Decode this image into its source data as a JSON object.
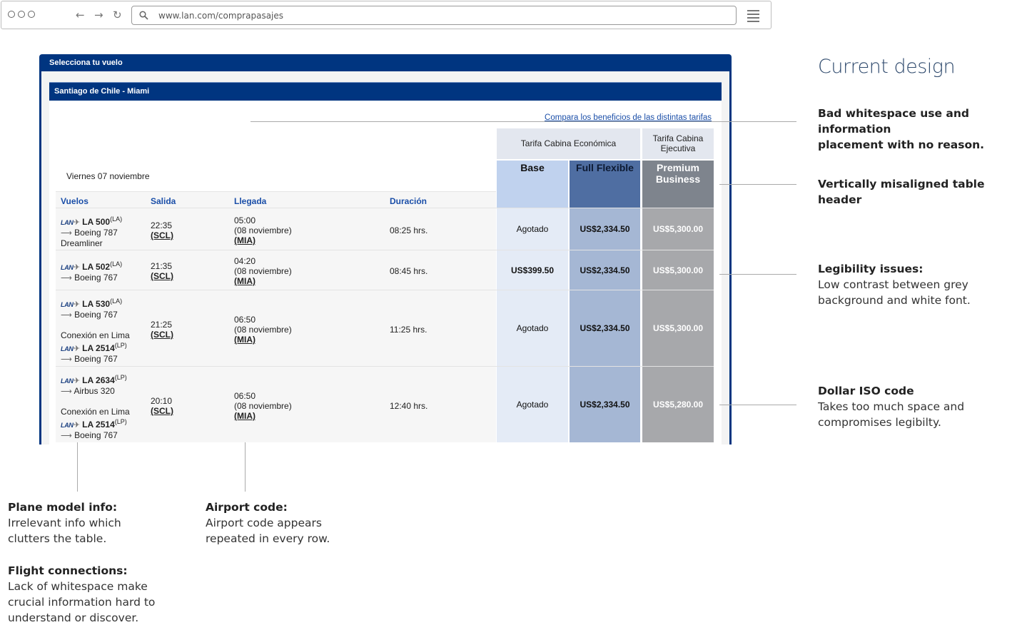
{
  "browser": {
    "url": "www.lan.com/comprapasajes"
  },
  "panel": {
    "title": "Selecciona tu vuelo",
    "route": "Santiago de Chile - Miami",
    "compare_link": "Compara los beneficios de las distintas tarifas",
    "date": "Viernes 07 noviembre",
    "fare_groups": {
      "economy": "Tarifa Cabina Económica",
      "executive_line1": "Tarifa Cabina",
      "executive_line2": "Ejecutiva"
    },
    "fares": {
      "base": "Base",
      "full": "Full Flexible",
      "premium_line1": "Premium",
      "premium_line2": "Business"
    },
    "columns": {
      "vuelos": "Vuelos",
      "salida": "Salida",
      "llegada": "Llegada",
      "duracion": "Duración"
    },
    "airline_logo": "LAN",
    "rows": [
      {
        "flight": "LA 500",
        "carrier": "(LA)",
        "plane": "Boeing 787",
        "plane2": "Dreamliner",
        "dep_time": "22:35",
        "dep_code": "(SCL)",
        "arr_time": "05:00",
        "arr_date": "(08 noviembre)",
        "arr_code": "(MIA)",
        "duration": "08:25 hrs.",
        "base": "Agotado",
        "full": "US$2,334.50",
        "premium": "US$5,300.00"
      },
      {
        "flight": "LA 502",
        "carrier": "(LA)",
        "plane": "Boeing 767",
        "dep_time": "21:35",
        "dep_code": "(SCL)",
        "arr_time": "04:20",
        "arr_date": "(08 noviembre)",
        "arr_code": "(MIA)",
        "duration": "08:45 hrs.",
        "base": "US$399.50",
        "full": "US$2,334.50",
        "premium": "US$5,300.00"
      },
      {
        "flight": "LA 530",
        "carrier": "(LA)",
        "plane": "Boeing 767",
        "connection": "Conexión en Lima",
        "flight2": "LA 2514",
        "carrier2": "(LP)",
        "plane2": "Boeing 767",
        "dep_time": "21:25",
        "dep_code": "(SCL)",
        "arr_time": "06:50",
        "arr_date": "(08 noviembre)",
        "arr_code": "(MIA)",
        "duration": "11:25 hrs.",
        "base": "Agotado",
        "full": "US$2,334.50",
        "premium": "US$5,300.00"
      },
      {
        "flight": "LA 2634",
        "carrier": "(LP)",
        "plane": "Airbus 320",
        "connection": "Conexión en Lima",
        "flight2": "LA 2514",
        "carrier2": "(LP)",
        "plane2": "Boeing 767",
        "dep_time": "20:10",
        "dep_code": "(SCL)",
        "arr_time": "06:50",
        "arr_date": "(08 noviembre)",
        "arr_code": "(MIA)",
        "duration": "12:40 hrs.",
        "base": "Agotado",
        "full": "US$2,334.50",
        "premium": "US$5,280.00"
      }
    ]
  },
  "annotations": {
    "title": "Current design",
    "whitespace": {
      "line1": "Bad whitespace use and information",
      "line2": "placement with no reason."
    },
    "header": {
      "title": "Vertically misaligned table header"
    },
    "legibility": {
      "title": "Legibility issues:",
      "line1": "Low contrast between grey",
      "line2": "background and white font."
    },
    "iso": {
      "title": "Dollar ISO code",
      "line1": "Takes too much space and",
      "line2": "compromises legibilty."
    },
    "plane": {
      "title": "Plane model info:",
      "line1": "Irrelevant info which",
      "line2": "clutters the table."
    },
    "airport": {
      "title": "Airport code:",
      "line1": "Airport code appears",
      "line2": "repeated in every row."
    },
    "connections": {
      "title": "Flight connections:",
      "line1": "Lack of whitespace make",
      "line2": "crucial information hard to",
      "line3": "understand or discover."
    }
  },
  "colors": {
    "lan_blue": "#003580",
    "link_blue": "#1a4ea8",
    "base_header": "#c0d2ee",
    "full_header": "#4f6ea2",
    "premium_header": "#7e848d"
  }
}
